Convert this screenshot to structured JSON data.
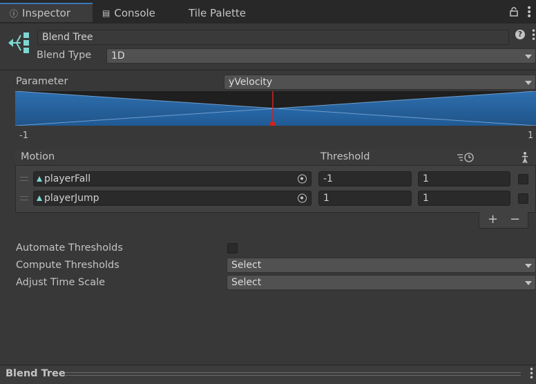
{
  "tabs": [
    {
      "label": "Inspector",
      "icon": "info-icon"
    },
    {
      "label": "Console",
      "icon": "console-icon"
    },
    {
      "label": "Tile Palette",
      "icon": ""
    }
  ],
  "header": {
    "name_value": "Blend Tree",
    "blend_type_label": "Blend Type",
    "blend_type_value": "1D"
  },
  "parameter": {
    "label": "Parameter",
    "value": "yVelocity",
    "range_min": "-1",
    "range_max": "1",
    "marker_fraction": 0.5
  },
  "motion_table": {
    "motion_header": "Motion",
    "threshold_header": "Threshold",
    "rows": [
      {
        "motion": "playerFall",
        "threshold": "-1",
        "time_scale": "1"
      },
      {
        "motion": "playerJump",
        "threshold": "1",
        "time_scale": "1"
      }
    ],
    "add_label": "+",
    "remove_label": "−"
  },
  "options": {
    "automate_label": "Automate Thresholds",
    "compute_label": "Compute Thresholds",
    "compute_value": "Select",
    "adjust_label": "Adjust Time Scale",
    "adjust_value": "Select"
  },
  "footer": {
    "title": "Blend Tree"
  },
  "colors": {
    "accent": "#3a79bb",
    "graph_fill": "#2a6db1",
    "marker": "#d62020"
  }
}
